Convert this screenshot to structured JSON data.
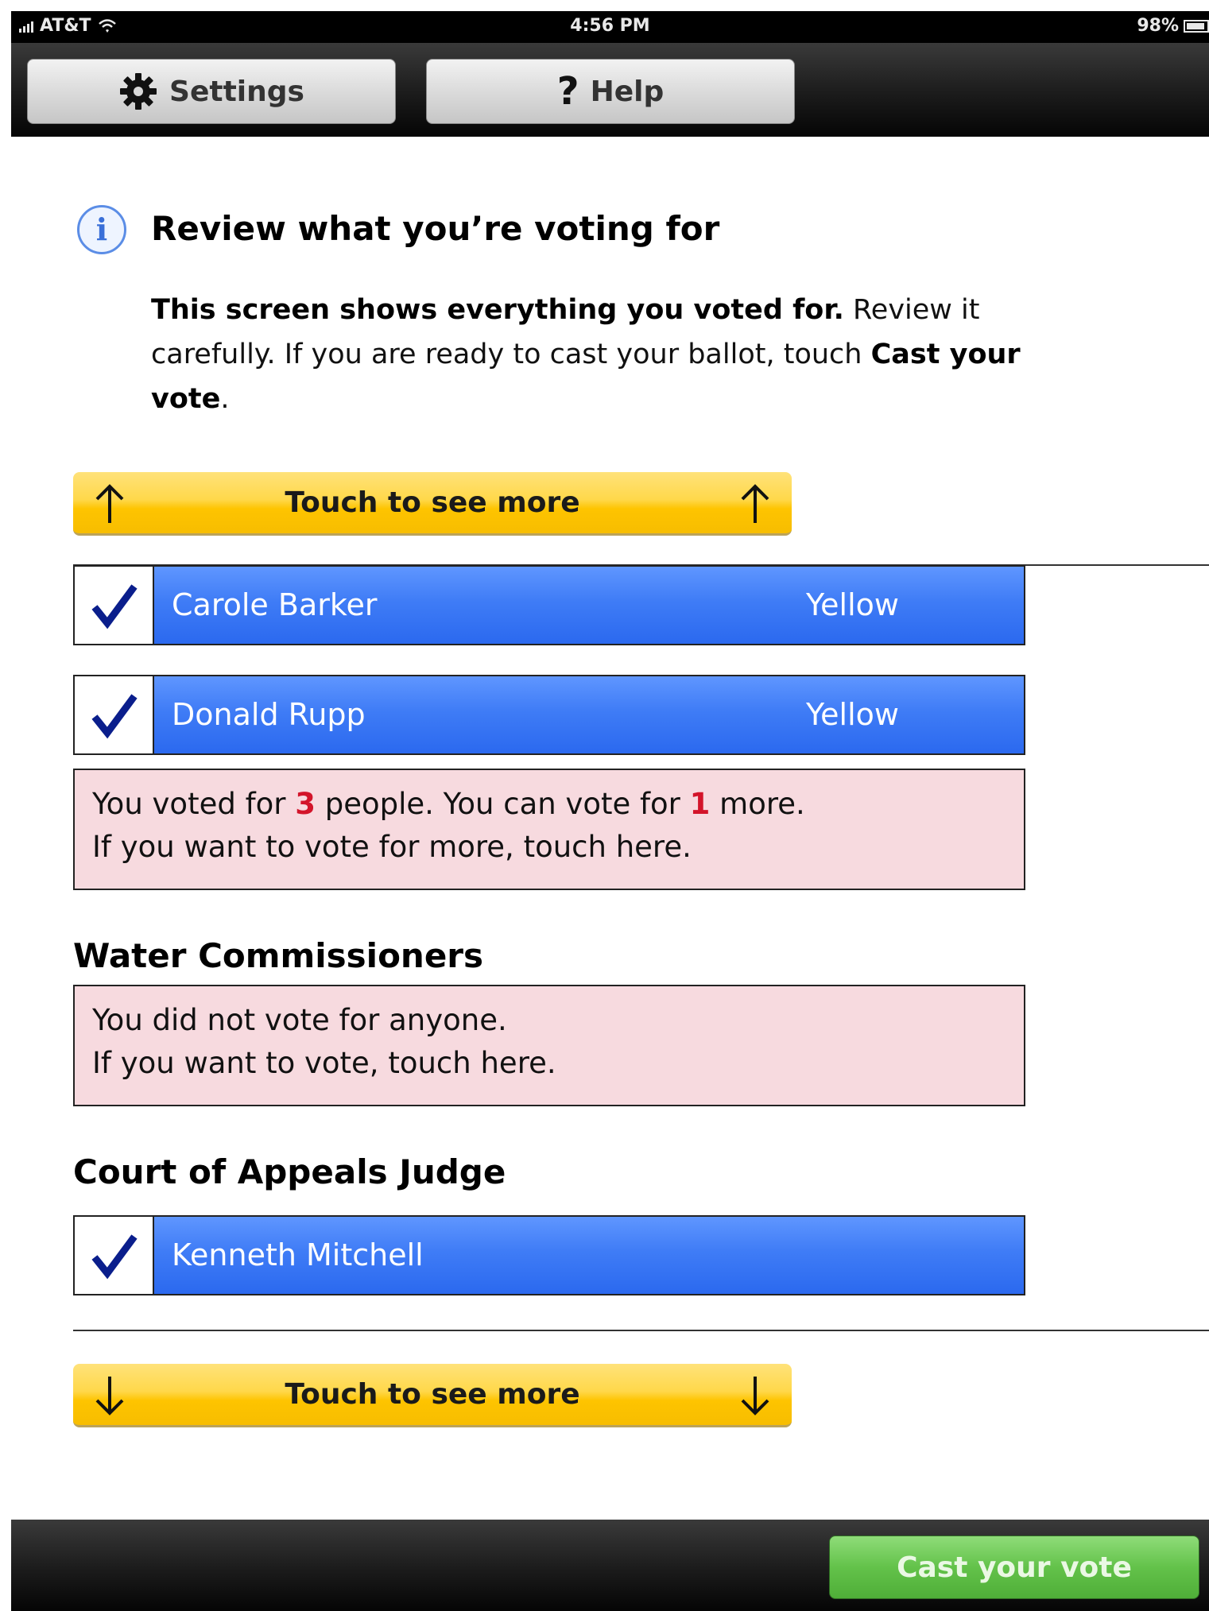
{
  "status_bar": {
    "carrier": "AT&T",
    "time": "4:56 PM",
    "battery": "98%"
  },
  "toolbar": {
    "settings_label": "Settings",
    "help_label": "Help"
  },
  "review": {
    "title": "Review what you’re voting for",
    "intro_bold": "This screen shows everything you voted for.",
    "intro_text": " Review it carefully. If you are ready to cast your ballot, touch ",
    "intro_action": "Cast your vote",
    "intro_end": "."
  },
  "scroll": {
    "up_label": "Touch to see more",
    "down_label": "Touch to see more"
  },
  "contest_1": {
    "candidates": [
      {
        "name": "Carole Barker",
        "party": "Yellow"
      },
      {
        "name": "Donald Rupp",
        "party": "Yellow"
      }
    ],
    "notice": {
      "line1_a": "You voted for ",
      "voted_count": "3",
      "line1_b": " people. You can vote for ",
      "remaining_count": "1",
      "line1_c": " more.",
      "line2": "If you want to vote for more, touch here."
    }
  },
  "contest_2": {
    "title": "Water Commissioners",
    "notice": {
      "line1": "You did not vote for anyone.",
      "line2": "If you want to vote, touch here."
    }
  },
  "contest_3": {
    "title": "Court of Appeals Judge",
    "candidates": [
      {
        "name": "Kenneth Mitchell",
        "party": ""
      }
    ]
  },
  "bottom_bar": {
    "cast_label": "Cast your vote"
  },
  "colors": {
    "candidate_bar": "#3f7cf6",
    "notice_bg": "#f7dadf",
    "count_red": "#d3142a",
    "scroll_yellow": "#fec400",
    "cast_green": "#63c24a"
  }
}
